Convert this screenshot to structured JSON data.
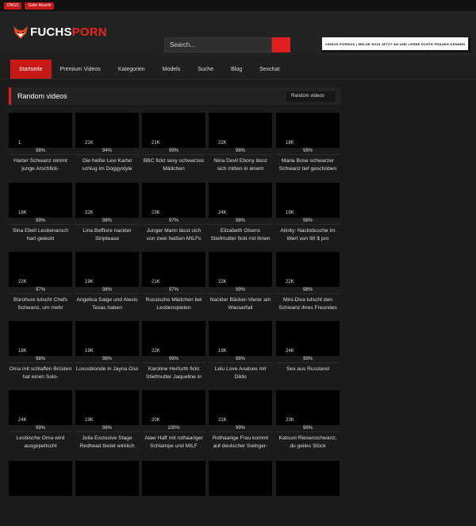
{
  "topbar": {
    "tags": [
      "DNGS",
      "Geile Muschi"
    ]
  },
  "logo": {
    "part1": "FUCHS",
    "part2": "PORN"
  },
  "search": {
    "placeholder": "Search..."
  },
  "banner": {
    "text": "VIDEOS PORNOS | MELDE DICH JETZT AN UND LERNE ECHTE FRAUEN KENNEN"
  },
  "nav": [
    "Startseite",
    "Premium Videos",
    "Kategorien",
    "Models",
    "Suche",
    "Blog",
    "Sexchat"
  ],
  "panel": {
    "title": "Random videos",
    "select": "Random videos"
  },
  "videos": [
    {
      "views": "1",
      "rating": "98%",
      "title": "Harter Schwanz nimmt junge Arschfick-"
    },
    {
      "views": "21K",
      "rating": "94%",
      "title": "Die heiße Lexi Kartel schlug im Doggystyle"
    },
    {
      "views": "21K",
      "rating": "99%",
      "title": "BBC fickt sexy schwarzes Mädchen"
    },
    {
      "views": "22K",
      "rating": "98%",
      "title": "Nina Devil Ebony lässt sich mitten in einem"
    },
    {
      "views": "18K",
      "rating": "99%",
      "title": "Maria Bose schwarzer Schwanz tief geschoben"
    },
    {
      "views": "18K",
      "rating": "99%",
      "title": "Sina Ebell Lesbenarsch hart geleckt"
    },
    {
      "views": "22K",
      "rating": "98%",
      "title": "Lina Beffiore nackter Striptease"
    },
    {
      "views": "23K",
      "rating": "97%",
      "title": "Junger Mann lässt sich von zwei heißen MILFs"
    },
    {
      "views": "24K",
      "rating": "98%",
      "title": "Elizabeth Olsens Stiefmutter fickt mit ihnen"
    },
    {
      "views": "19K",
      "rating": "98%",
      "title": "Alinity: Nacktdusche im Wert von 90 $ pro"
    },
    {
      "views": "22K",
      "rating": "97%",
      "title": "Bürohure lutscht Chefs Schwanz, um mehr"
    },
    {
      "views": "19K",
      "rating": "98%",
      "title": "Angelica Saige und Alexis Texas haben"
    },
    {
      "views": "21K",
      "rating": "97%",
      "title": "Russische Mädchen bei Lesbenspielen"
    },
    {
      "views": "22K",
      "rating": "99%",
      "title": "Nackter Bäcker-Vierer am Wasserfall"
    },
    {
      "views": "22K",
      "rating": "98%",
      "title": "Mini-Diva lutscht den Schwanz ihres Freundes"
    },
    {
      "views": "18K",
      "rating": "98%",
      "title": "Oma mit schlaffen Brüsten hat einen Solo-"
    },
    {
      "views": "19K",
      "rating": "98%",
      "title": "Luxusblonde in Jayna Oso"
    },
    {
      "views": "22K",
      "rating": "99%",
      "title": "Karoline Herfurth fickt Stiefmutter Jaqueline in"
    },
    {
      "views": "19K",
      "rating": "98%",
      "title": "Lelu Love Analsex mit Dildo"
    },
    {
      "views": "24K",
      "rating": "99%",
      "title": "Sex aus Russland"
    },
    {
      "views": "24K",
      "rating": "99%",
      "title": "Lesbische Oma wird ausgepeitscht"
    },
    {
      "views": "19K",
      "rating": "98%",
      "title": "Julia Exclusive Stage Redhead bietet wirklich"
    },
    {
      "views": "20K",
      "rating": "100%",
      "title": "Alaw Haff mit rothaariger Schlampe und MILF"
    },
    {
      "views": "21K",
      "rating": "99%",
      "title": "Rothaarige Frau kommt auf deutscher Swinger-"
    },
    {
      "views": "23K",
      "rating": "99%",
      "title": "Katsuni Riesenschwanz, du geiles Stück"
    }
  ],
  "colors": {
    "accent": "#e21f1f",
    "background": "#1b1b1b",
    "header": "#222222"
  }
}
